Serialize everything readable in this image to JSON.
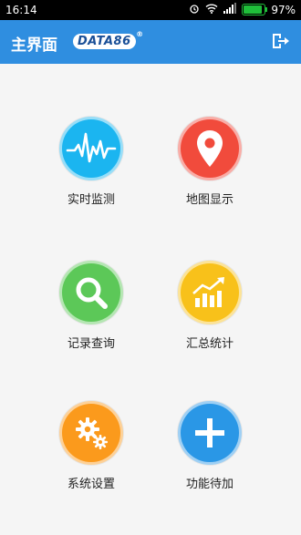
{
  "status": {
    "time": "16:14",
    "battery": "97%",
    "battery_level": 0.97
  },
  "appbar": {
    "title": "主界面",
    "logo": "DATA86",
    "logo_mark": "®"
  },
  "tiles": [
    {
      "label": "实时监测",
      "color": "#1bb5f0",
      "icon": "heartbeat-icon"
    },
    {
      "label": "地图显示",
      "color": "#f14b3c",
      "icon": "map-pin-icon"
    },
    {
      "label": "记录查询",
      "color": "#5cc858",
      "icon": "search-icon"
    },
    {
      "label": "汇总统计",
      "color": "#f8c11a",
      "icon": "trend-chart-icon"
    },
    {
      "label": "系统设置",
      "color": "#fb9a1c",
      "icon": "gears-icon"
    },
    {
      "label": "功能待加",
      "color": "#2a97e6",
      "icon": "plus-icon"
    }
  ]
}
